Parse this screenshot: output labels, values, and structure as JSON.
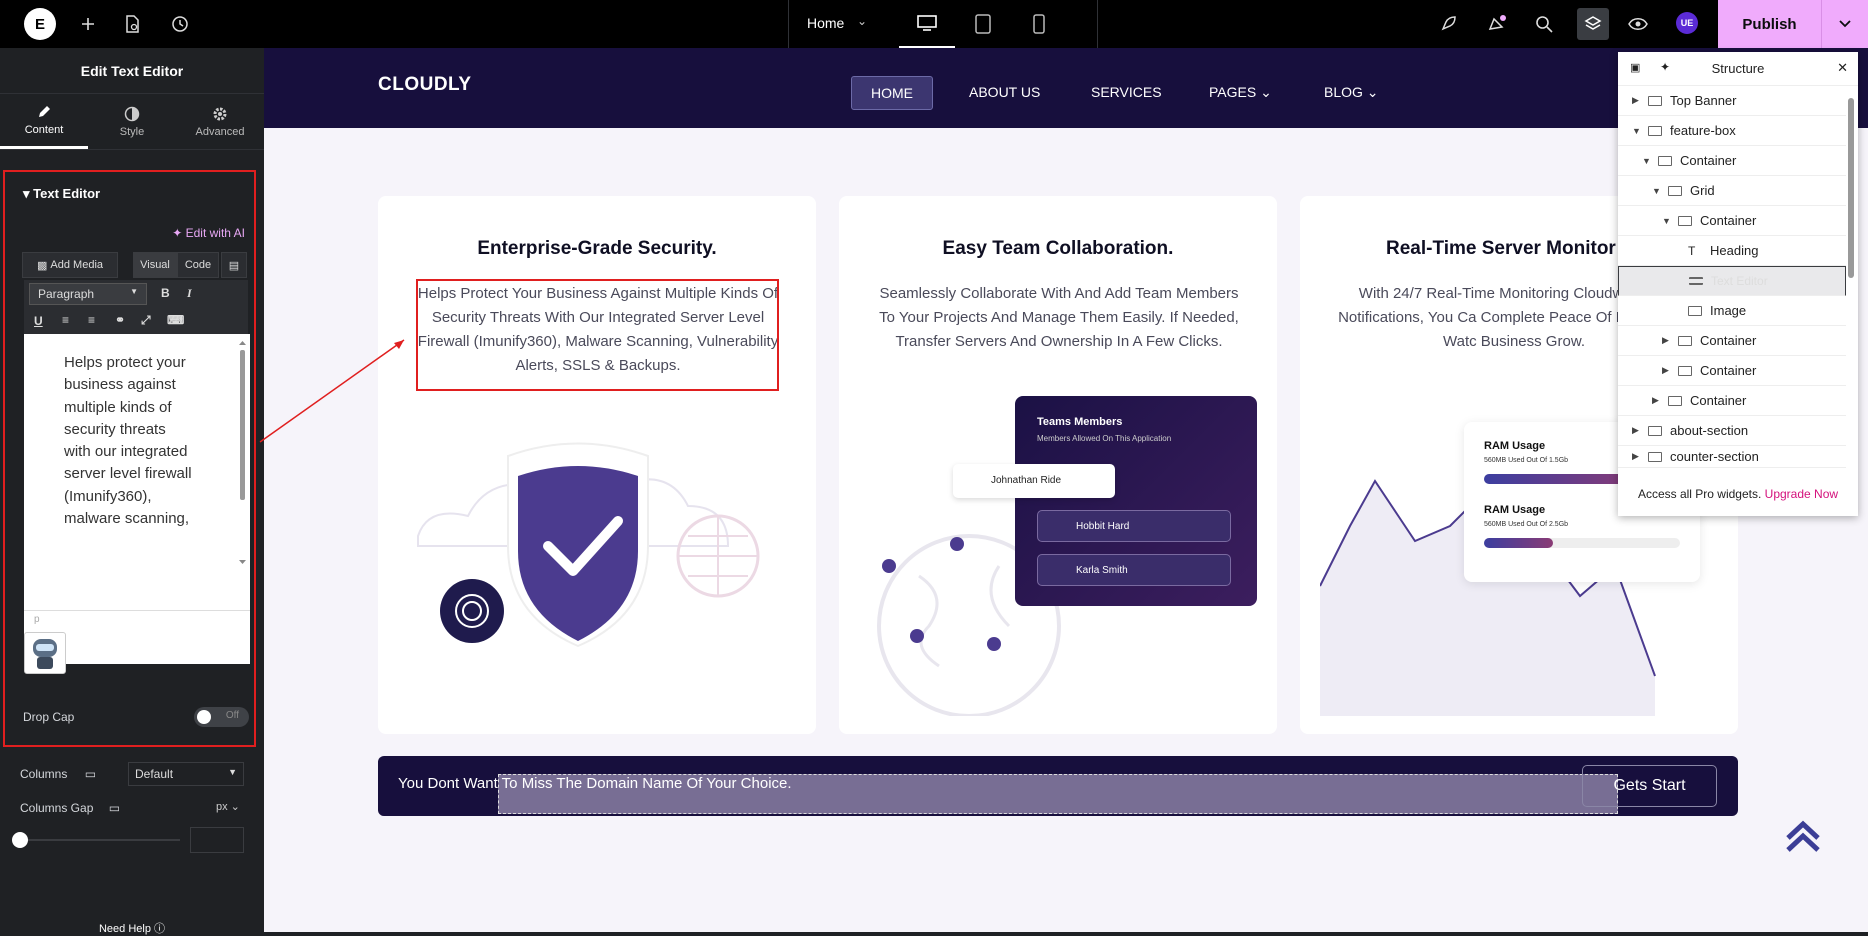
{
  "topbar": {
    "logo": "E",
    "page_name": "Home",
    "publish_label": "Publish"
  },
  "panel": {
    "title": "Edit Text Editor",
    "tabs": [
      {
        "label": "Content"
      },
      {
        "label": "Style"
      },
      {
        "label": "Advanced"
      }
    ],
    "section_title": "Text Editor",
    "edit_ai": "Edit with AI",
    "add_media": "Add Media",
    "visual": "Visual",
    "code": "Code",
    "paragraph": "Paragraph",
    "editor_text": "Helps protect your business against multiple kinds of security threats with our integrated server level firewall (Imunify360), malware scanning,",
    "path_label": "p",
    "drop_cap": "Drop Cap",
    "toggle_off": "Off",
    "columns_label": "Columns",
    "columns_value": "Default",
    "columns_gap_label": "Columns Gap",
    "gap_unit": "px",
    "need_help": "Need Help"
  },
  "site": {
    "brand": "CLOUDLY",
    "nav": [
      "HOME",
      "ABOUT US",
      "SERVICES",
      "PAGES",
      "BLOG"
    ],
    "cards": [
      {
        "title": "Enterprise-Grade Security.",
        "text": "Helps Protect Your Business Against Multiple Kinds Of Security Threats With Our Integrated Server Level Firewall (Imunify360), Malware Scanning, Vulnerability Alerts, SSLS & Backups."
      },
      {
        "title": "Easy Team Collaboration.",
        "text": "Seamlessly Collaborate With And Add Team Members To Your Projects And Manage Them Easily. If Needed, Transfer Servers And Ownership In A Few Clicks."
      },
      {
        "title": "Real-Time Server Monitor",
        "text": "With 24/7 Real-Time Monitoring CloudwaysBot Notifications, You Ca Complete Peace Of Mind While Watc Business Grow."
      }
    ],
    "team": {
      "title": "Teams Members",
      "subtitle": "Members Allowed On This Application",
      "members": [
        "Johnathan Ride",
        "Hobbit Hard",
        "Karla Smith"
      ]
    },
    "ram": [
      {
        "title": "RAM Usage",
        "detail": "560MB  Used Out Of 1.5Gb",
        "fill": 0.8
      },
      {
        "title": "RAM Usage",
        "detail": "560MB  Used Out Of 2.5Gb",
        "fill": 0.35
      }
    ],
    "banner_text": "You Dont Want To Miss The Domain Name Of Your Choice.",
    "banner_button": "Gets Start"
  },
  "structure": {
    "title": "Structure",
    "rows": [
      {
        "label": "Top Banner"
      },
      {
        "label": "feature-box"
      },
      {
        "label": "Container"
      },
      {
        "label": "Grid"
      },
      {
        "label": "Container"
      },
      {
        "label": "Heading"
      },
      {
        "label": "Text Editor"
      },
      {
        "label": "Image"
      },
      {
        "label": "Container"
      },
      {
        "label": "Container"
      },
      {
        "label": "Container"
      },
      {
        "label": "about-section"
      },
      {
        "label": "counter-section"
      }
    ],
    "footer_text": "Access all Pro widgets.",
    "footer_link": "Upgrade Now"
  },
  "colors": {
    "accent": "#f0abfc",
    "nav_bg": "#170f3d",
    "selection": "#e01f1f"
  }
}
